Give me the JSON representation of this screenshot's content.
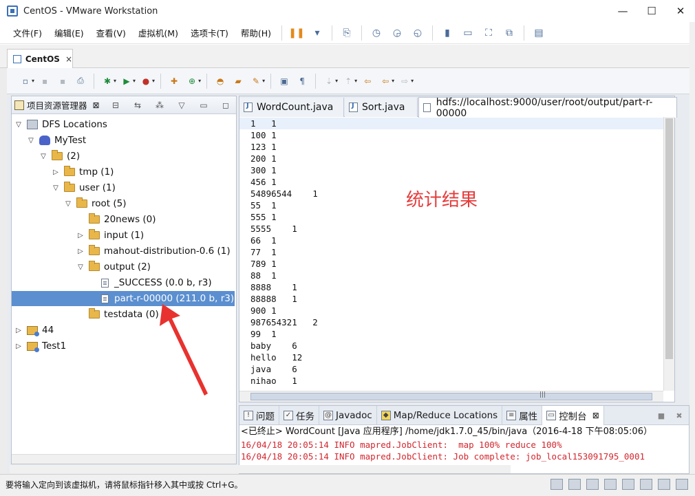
{
  "vm": {
    "window_title": "CentOS - VMware Workstation",
    "menu": [
      "文件(F)",
      "编辑(E)",
      "查看(V)",
      "虚拟机(M)",
      "选项卡(T)",
      "帮助(H)"
    ],
    "tab_label": "CentOS",
    "tab_close": "×",
    "status_hint": "要将输入定向到该虚拟机，请将鼠标指针移入其中或按 Ctrl+G。"
  },
  "explorer": {
    "title": "项目资源管理器",
    "close": "⊠",
    "tree": [
      {
        "label": "DFS Locations",
        "depth": 0,
        "toggle": "▽",
        "icon": "dfs",
        "selected": false
      },
      {
        "label": "MyTest",
        "depth": 1,
        "toggle": "▽",
        "icon": "elephant",
        "selected": false
      },
      {
        "label": "(2)",
        "depth": 2,
        "toggle": "▽",
        "icon": "folder",
        "selected": false
      },
      {
        "label": "tmp (1)",
        "depth": 3,
        "toggle": "▷",
        "icon": "folder",
        "selected": false
      },
      {
        "label": "user (1)",
        "depth": 3,
        "toggle": "▽",
        "icon": "folder",
        "selected": false
      },
      {
        "label": "root (5)",
        "depth": 4,
        "toggle": "▽",
        "icon": "folder",
        "selected": false
      },
      {
        "label": "20news (0)",
        "depth": 5,
        "toggle": "",
        "icon": "folder",
        "selected": false
      },
      {
        "label": "input (1)",
        "depth": 5,
        "toggle": "▷",
        "icon": "folder",
        "selected": false
      },
      {
        "label": "mahout-distribution-0.6 (1)",
        "depth": 5,
        "toggle": "▷",
        "icon": "folder",
        "selected": false
      },
      {
        "label": "output (2)",
        "depth": 5,
        "toggle": "▽",
        "icon": "folder",
        "selected": false
      },
      {
        "label": "_SUCCESS (0.0 b, r3)",
        "depth": 6,
        "toggle": "",
        "icon": "file",
        "selected": false
      },
      {
        "label": "part-r-00000 (211.0 b, r3)",
        "depth": 6,
        "toggle": "",
        "icon": "file",
        "selected": true
      },
      {
        "label": "testdata (0)",
        "depth": 5,
        "toggle": "",
        "icon": "folder",
        "selected": false
      },
      {
        "label": "44",
        "depth": 0,
        "toggle": "▷",
        "icon": "project",
        "selected": false
      },
      {
        "label": "Test1",
        "depth": 0,
        "toggle": "▷",
        "icon": "project",
        "selected": false
      }
    ]
  },
  "editor": {
    "tabs": [
      {
        "label": "WordCount.java",
        "active": false
      },
      {
        "label": "Sort.java",
        "active": false
      },
      {
        "label": "hdfs://localhost:9000/user/root/output/part-r-00000",
        "active": true
      }
    ],
    "lines": [
      "1   1",
      "100 1",
      "123 1",
      "200 1",
      "300 1",
      "456 1",
      "54896544    1",
      "55  1",
      "555 1",
      "5555    1",
      "66  1",
      "77  1",
      "789 1",
      "88  1",
      "8888    1",
      "88888   1",
      "900 1",
      "987654321   2",
      "99  1",
      "baby    6",
      "hello   12",
      "java    6",
      "nihao   1"
    ],
    "annotation": "统计结果",
    "hscroll_grip": "|||"
  },
  "console": {
    "tabs": [
      {
        "label": "问题",
        "active": false,
        "close": false
      },
      {
        "label": "任务",
        "active": false,
        "close": false
      },
      {
        "label": "Javadoc",
        "active": false,
        "close": false
      },
      {
        "label": "Map/Reduce Locations",
        "active": false,
        "close": false
      },
      {
        "label": "属性",
        "active": false,
        "close": false
      },
      {
        "label": "控制台",
        "active": true,
        "close": true
      }
    ],
    "header": "<已终止> WordCount [Java 应用程序] /home/jdk1.7.0_45/bin/java（2016-4-18 下午08:05:06）",
    "logs": [
      "16/04/18 20:05:14 INFO mapred.JobClient:  map 100% reduce 100%",
      "16/04/18 20:05:14 INFO mapred.JobClient: Job complete: job_local153091795_0001"
    ]
  },
  "colors": {
    "selection": "#5b8fd0",
    "annotation": "#e53c3c",
    "arrow": "#e8322f",
    "console_text": "#d2262e"
  }
}
